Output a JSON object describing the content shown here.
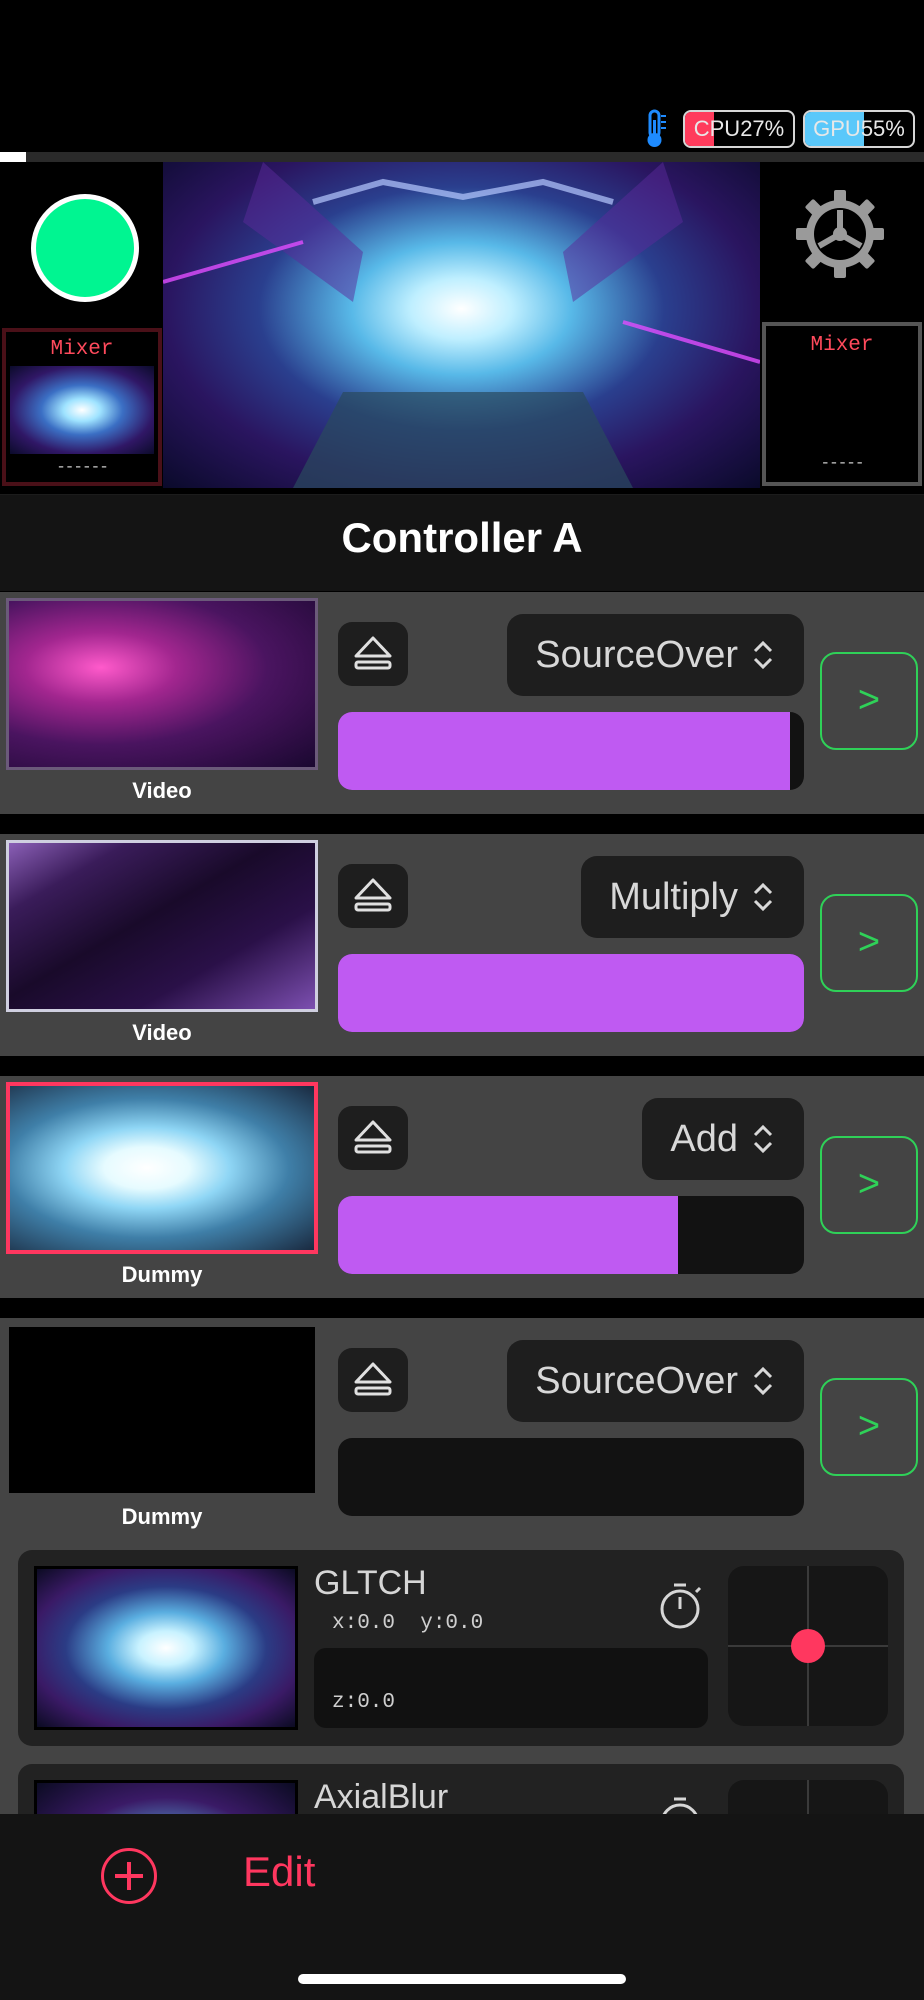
{
  "status": {
    "cpu_label": "CPU27%",
    "cpu_percent": 27,
    "gpu_label": "GPU55%",
    "gpu_percent": 55,
    "thermo_icon": "thermometer-icon"
  },
  "preview": {
    "left_mixer_label": "Mixer",
    "left_mixer_dash": "------",
    "right_mixer_label": "Mixer",
    "right_mixer_dash": "-----"
  },
  "controller_title": "Controller A",
  "layers": [
    {
      "label": "Video",
      "blend": "SourceOver",
      "opacity": 0.97
    },
    {
      "label": "Video",
      "blend": "Multiply",
      "opacity": 1.0
    },
    {
      "label": "Dummy",
      "blend": "Add",
      "opacity": 0.73
    },
    {
      "label": "Dummy",
      "blend": "SourceOver",
      "opacity": 0.0
    }
  ],
  "go_label": ">",
  "effects": [
    {
      "name": "GLTCH",
      "xy": "x:0.0  y:0.0",
      "z": "z:0.0"
    },
    {
      "name": "AxialBlur",
      "xy": "",
      "z": ""
    }
  ],
  "bottom": {
    "edit_label": "Edit"
  },
  "colors": {
    "accent": "#ff375f",
    "slider": "#bf5af2",
    "go": "#2fd158",
    "record": "#00f591"
  }
}
